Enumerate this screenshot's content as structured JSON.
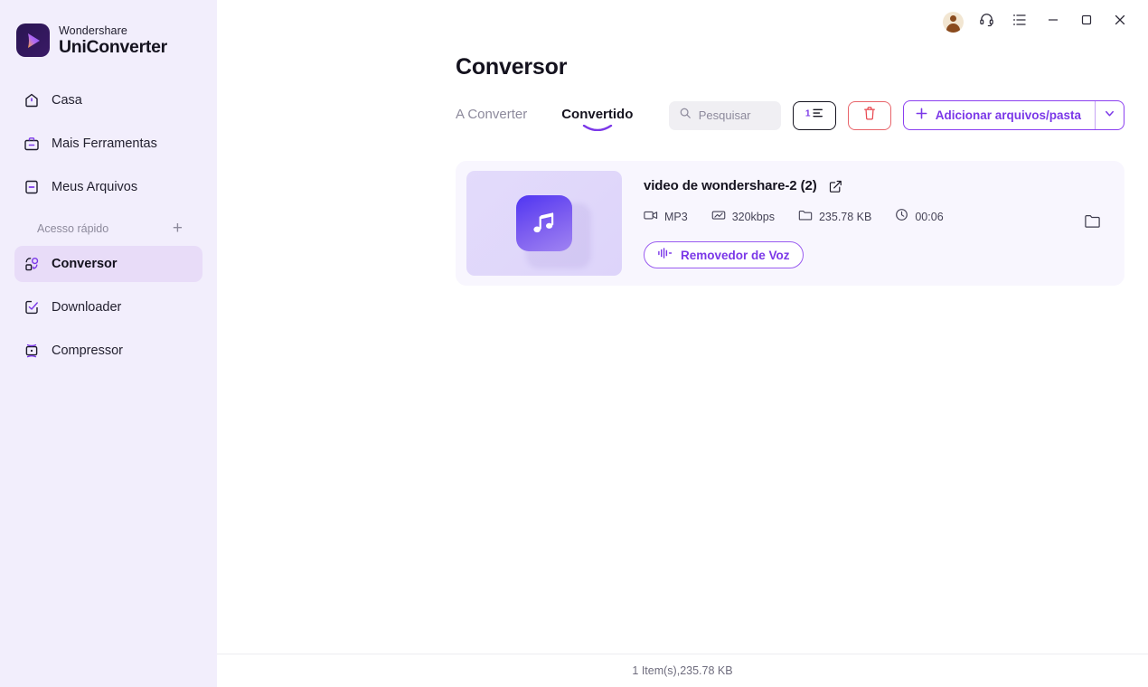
{
  "brand": {
    "top": "Wondershare",
    "bottom": "UniConverter",
    "logo_icon": "play-triangle-logo",
    "accent": "#7b38e8"
  },
  "titlebar": {
    "buttons": [
      {
        "name": "account-avatar",
        "icon": "user-avatar-icon",
        "glyph": ""
      },
      {
        "name": "support-button",
        "icon": "headset-icon",
        "glyph": ""
      },
      {
        "name": "menu-button",
        "icon": "list-menu-icon",
        "glyph": ""
      },
      {
        "name": "minimize-button",
        "icon": "minimize-icon",
        "glyph": ""
      },
      {
        "name": "maximize-button",
        "icon": "maximize-icon",
        "glyph": ""
      },
      {
        "name": "close-button",
        "icon": "close-icon",
        "glyph": ""
      }
    ]
  },
  "sidebar": {
    "items": [
      {
        "label": "Casa",
        "icon": "home-icon",
        "active": false
      },
      {
        "label": "Mais Ferramentas",
        "icon": "toolbox-icon",
        "active": false
      },
      {
        "label": "Meus Arquivos",
        "icon": "my-files-icon",
        "active": false
      }
    ],
    "quick_access": {
      "label": "Acesso rápido",
      "add_icon": "plus-icon"
    },
    "quick_items": [
      {
        "label": "Conversor",
        "icon": "converter-icon",
        "active": true
      },
      {
        "label": "Downloader",
        "icon": "downloader-icon",
        "active": false
      },
      {
        "label": "Compressor",
        "icon": "compressor-icon",
        "active": false
      }
    ]
  },
  "header": {
    "title": "Conversor"
  },
  "tabs": [
    {
      "label": "A Converter",
      "active": false
    },
    {
      "label": "Convertido",
      "active": true
    }
  ],
  "toolbar": {
    "search_placeholder": "Pesquisar",
    "search_value": "",
    "search_icon": "search-icon",
    "sort_icon": "sort-numeric-icon",
    "delete_icon": "trash-icon",
    "add_label": "Adicionar arquivos/pasta",
    "add_plus_icon": "plus-icon",
    "add_caret_icon": "chevron-down-icon"
  },
  "files": [
    {
      "name": "video de wondershare-2 (2)",
      "edit_icon": "edit-square-icon",
      "thumb_icon": "music-note-icon",
      "meta": [
        {
          "icon": "video-camera-icon",
          "text": "MP3"
        },
        {
          "icon": "resolution-icon",
          "text": "320kbps"
        },
        {
          "icon": "folder-icon",
          "text": "235.78 KB"
        },
        {
          "icon": "clock-icon",
          "text": "00:06"
        }
      ],
      "action": {
        "label": "Removedor de Voz",
        "icon": "waveform-icon"
      },
      "open_folder_icon": "folder-open-icon"
    }
  ],
  "statusbar": {
    "text": "1 Item(s),235.78 KB"
  }
}
